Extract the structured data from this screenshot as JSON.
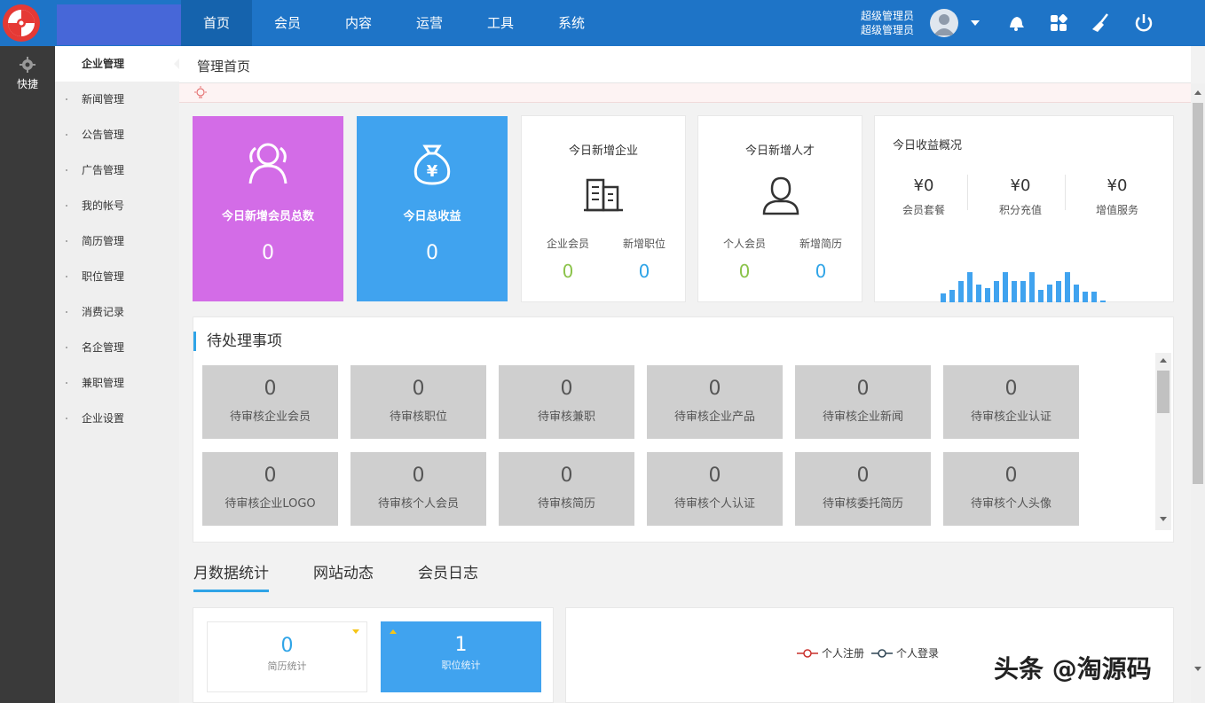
{
  "topbar": {
    "nav": [
      "首页",
      "会员",
      "内容",
      "运营",
      "工具",
      "系统"
    ],
    "admin_line1": "超级管理员",
    "admin_line2": "超级管理员",
    "icons": [
      "bell-icon",
      "apps-icon",
      "clean-icon",
      "power-icon"
    ],
    "bg_color": "#1e74c7"
  },
  "leftbar": {
    "quick_label": "快捷"
  },
  "submenu": {
    "items": [
      "企业管理",
      "新闻管理",
      "公告管理",
      "广告管理",
      "我的帐号",
      "简历管理",
      "职位管理",
      "消费记录",
      "名企管理",
      "兼职管理",
      "企业设置"
    ]
  },
  "breadcrumb": "管理首页",
  "stats": {
    "members": {
      "label": "今日新增会员总数",
      "value": "0",
      "color": "#d36ce7"
    },
    "income": {
      "label": "今日总收益",
      "value": "0",
      "color": "#40a3ef"
    },
    "company": {
      "title": "今日新增企业",
      "sub1": "企业会员",
      "val1": "0",
      "sub2": "新增职位",
      "val2": "0"
    },
    "talent": {
      "title": "今日新增人才",
      "sub1": "个人会员",
      "val1": "0",
      "sub2": "新增简历",
      "val2": "0"
    },
    "revenue": {
      "title": "今日收益概况",
      "items": [
        {
          "amount": "¥0",
          "caption": "会员套餐"
        },
        {
          "amount": "¥0",
          "caption": "积分充值"
        },
        {
          "amount": "¥0",
          "caption": "增值服务"
        }
      ]
    }
  },
  "pending": {
    "title": "待处理事项",
    "tiles": [
      {
        "value": "0",
        "label": "待审核企业会员"
      },
      {
        "value": "0",
        "label": "待审核职位"
      },
      {
        "value": "0",
        "label": "待审核兼职"
      },
      {
        "value": "0",
        "label": "待审核企业产品"
      },
      {
        "value": "0",
        "label": "待审核企业新闻"
      },
      {
        "value": "0",
        "label": "待审核企业认证"
      },
      {
        "value": "0",
        "label": "待审核企业LOGO"
      },
      {
        "value": "0",
        "label": "待审核个人会员"
      },
      {
        "value": "0",
        "label": "待审核简历"
      },
      {
        "value": "0",
        "label": "待审核个人认证"
      },
      {
        "value": "0",
        "label": "待审核委托简历"
      },
      {
        "value": "0",
        "label": "待审核个人头像"
      }
    ]
  },
  "tabs": [
    "月数据统计",
    "网站动态",
    "会员日志"
  ],
  "monthly": {
    "resume": {
      "value": "0",
      "caption": "简历统计"
    },
    "job": {
      "value": "1",
      "caption": "职位统计"
    },
    "legend": [
      "个人注册",
      "个人登录"
    ]
  },
  "watermark": "头条 @淘源码"
}
